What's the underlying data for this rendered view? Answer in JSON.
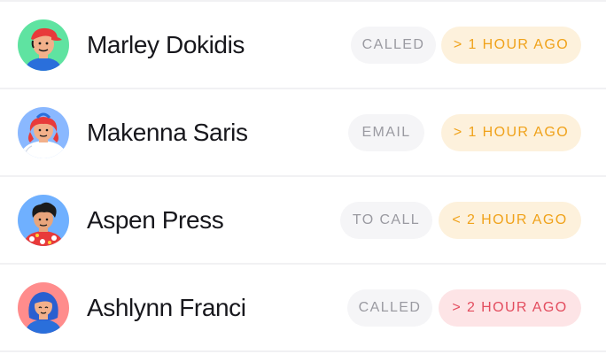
{
  "contacts": [
    {
      "name": "Marley Dokidis",
      "status": "CALLED",
      "time": "> 1 HOUR AGO",
      "time_level": "warn",
      "avatar_icon": "person-red-cap-avatar-icon",
      "avatar_bg": "#5fe3a1"
    },
    {
      "name": "Makenna Saris",
      "status": "EMAIL",
      "time": "> 1 HOUR AGO",
      "time_level": "warn",
      "avatar_icon": "person-red-hair-avatar-icon",
      "avatar_bg": "#8ab8ff"
    },
    {
      "name": "Aspen Press",
      "status": "TO CALL",
      "time": "< 2 HOUR AGO",
      "time_level": "warn",
      "avatar_icon": "person-dark-hair-avatar-icon",
      "avatar_bg": "#6fb0ff"
    },
    {
      "name": "Ashlynn Franci",
      "status": "CALLED",
      "time": "> 2 HOUR AGO",
      "time_level": "alert",
      "avatar_icon": "person-blue-hair-avatar-icon",
      "avatar_bg": "#ff8c8c"
    }
  ],
  "colors": {
    "warn_bg": "#fdf1dc",
    "warn_text": "#f0a21a",
    "alert_bg": "#fde4e6",
    "alert_text": "#e34c5e",
    "status_bg": "#f5f5f7",
    "status_text": "#9a9aa1"
  }
}
